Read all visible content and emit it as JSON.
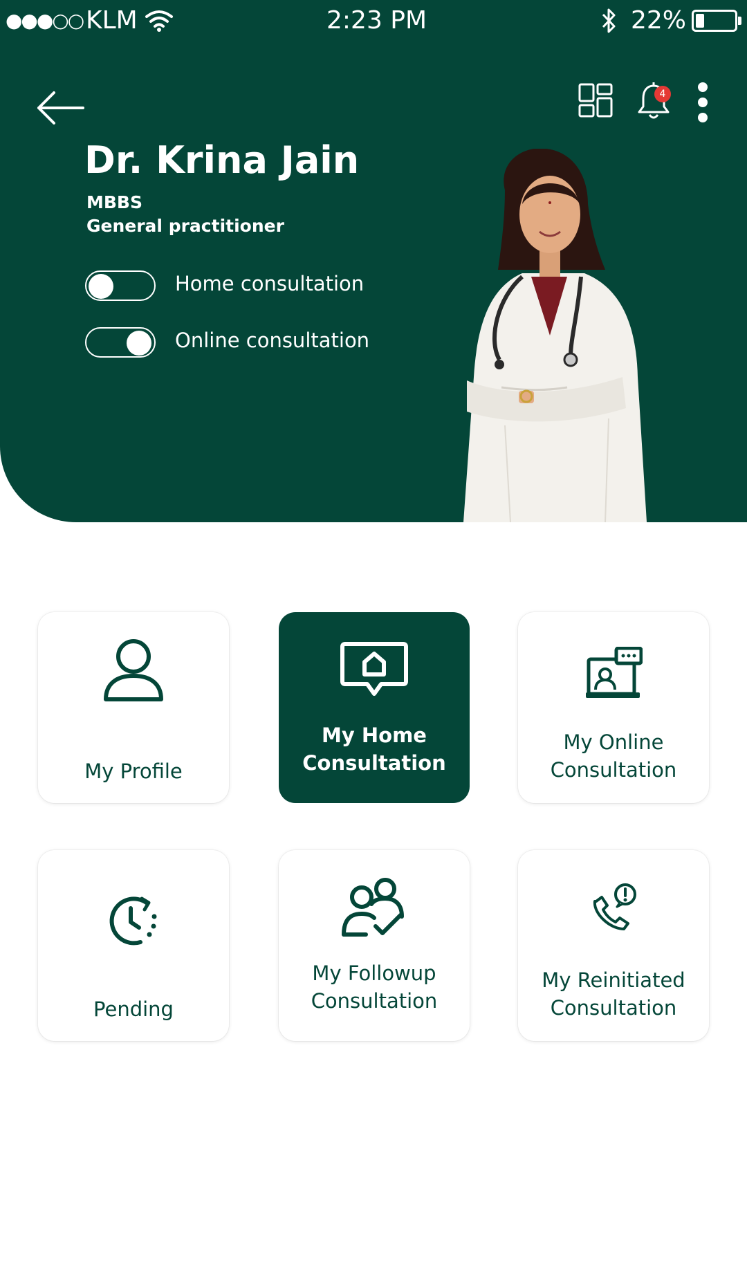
{
  "status_bar": {
    "signal": "●●●○○",
    "carrier": "KLM",
    "time": "2:23 PM",
    "battery_percent": "22%",
    "battery_level": 0.22
  },
  "header": {
    "notification_count": "4"
  },
  "doctor": {
    "name": "Dr. Krina Jain",
    "degree": "MBBS",
    "specialty": "General practitioner"
  },
  "toggles": [
    {
      "label": "Home consultation",
      "on": false
    },
    {
      "label": "Online consultation",
      "on": true
    }
  ],
  "menu": [
    {
      "label_line1": "My Profile",
      "label_line2": "",
      "icon": "user-icon",
      "selected": false
    },
    {
      "label_line1": "My Home",
      "label_line2": "Consultation",
      "icon": "home-message-icon",
      "selected": true
    },
    {
      "label_line1": "My Online",
      "label_line2": "Consultation",
      "icon": "online-video-icon",
      "selected": false
    },
    {
      "label_line1": "Pending",
      "label_line2": "",
      "icon": "clock-pending-icon",
      "selected": false
    },
    {
      "label_line1": "My Followup",
      "label_line2": "Consultation",
      "icon": "followup-users-icon",
      "selected": false
    },
    {
      "label_line1": "My Reinitiated",
      "label_line2": "Consultation",
      "icon": "phone-alert-icon",
      "selected": false
    }
  ],
  "colors": {
    "brand": "#044638",
    "background": "#ffffff",
    "badge": "#e53935"
  }
}
